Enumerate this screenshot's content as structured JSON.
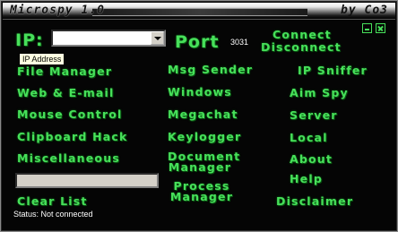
{
  "window": {
    "title": "Microspy 1.0",
    "author": "by Co3"
  },
  "ip": {
    "label": "IP:",
    "value": "",
    "tooltip": "IP Address"
  },
  "port": {
    "label": "Port",
    "value": "3031"
  },
  "connection": {
    "connect_label": "Connect",
    "disconnect_label": "Disconnect"
  },
  "menu": {
    "file_manager": "File Manager",
    "msg_sender": "Msg Sender",
    "ip_sniffer": "IP Sniffer",
    "web_email": "Web & E-mail",
    "windows": "Windows",
    "aim_spy": "Aim Spy",
    "mouse_control": "Mouse Control",
    "megachat": "Megachat",
    "server": "Server",
    "clipboard_hack": "Clipboard Hack",
    "keylogger": "Keylogger",
    "local": "Local",
    "miscellaneous": "Miscellaneous",
    "document_manager_1": "Document",
    "document_manager_2": "Manager",
    "about": "About",
    "process_manager_1": "Process",
    "process_manager_2": "Manager",
    "help": "Help",
    "clear_list": "Clear List",
    "disclaimer": "Disclaimer"
  },
  "status": "Status:  Not connected",
  "colors": {
    "accent_green": "#47e05a",
    "background": "#050505"
  },
  "icons": [
    "minimize-icon",
    "close-icon",
    "chevron-down-icon"
  ]
}
